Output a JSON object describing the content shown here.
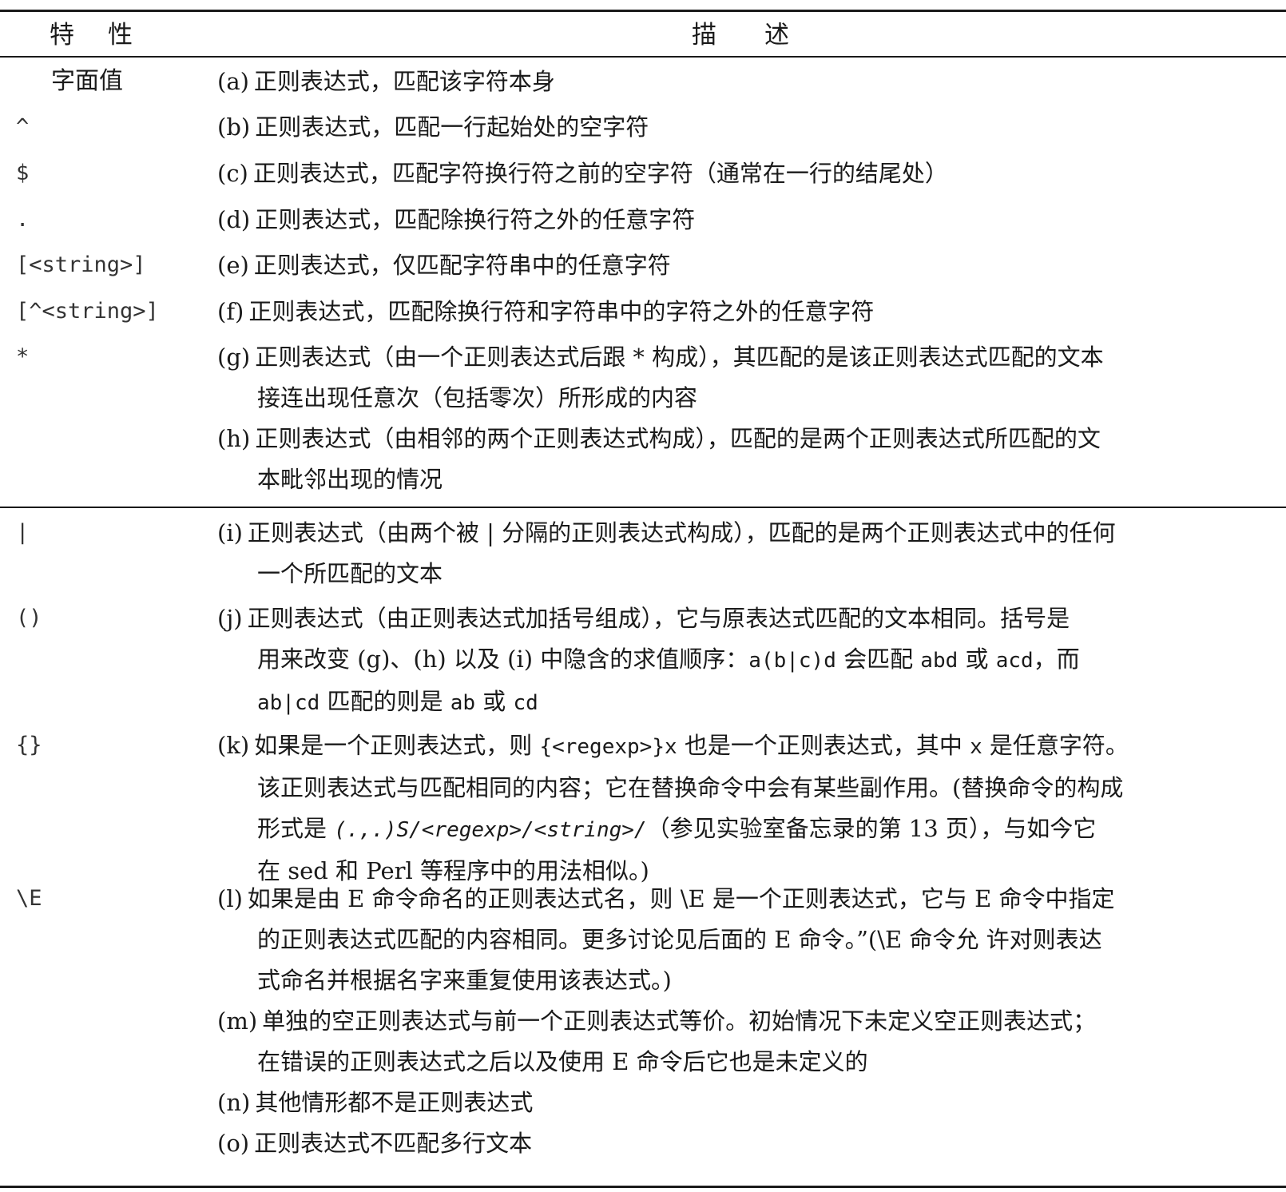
{
  "header": {
    "feature_a": "特",
    "feature_b": "性",
    "desc_a": "描",
    "desc_b": "述"
  },
  "rows": [
    {
      "feature": "字面值",
      "items": [
        {
          "tag": "(a)",
          "lines": [
            "正则表达式，匹配该字符本身"
          ]
        }
      ]
    },
    {
      "feature": "^",
      "items": [
        {
          "tag": "(b)",
          "lines": [
            "正则表达式，匹配一行起始处的空字符"
          ]
        }
      ]
    },
    {
      "feature": "$",
      "items": [
        {
          "tag": "(c)",
          "lines": [
            "正则表达式，匹配字符换行符之前的空字符（通常在一行的结尾处）"
          ]
        }
      ]
    },
    {
      "feature": ".",
      "items": [
        {
          "tag": "(d)",
          "lines": [
            "正则表达式，匹配除换行符之外的任意字符"
          ]
        }
      ]
    },
    {
      "feature": "[<string>]",
      "items": [
        {
          "tag": "(e)",
          "lines": [
            "正则表达式，仅匹配字符串中的任意字符"
          ]
        }
      ]
    },
    {
      "feature": "[^<string>]",
      "items": [
        {
          "tag": "(f)",
          "lines": [
            "正则表达式，匹配除换行符和字符串中的字符之外的任意字符"
          ]
        }
      ]
    },
    {
      "feature": "*",
      "items": [
        {
          "tag": "(g)",
          "lines": [
            "正则表达式（由一个正则表达式后跟 * 构成），其匹配的是该正则表达式匹配的文本",
            "接连出现任意次（包括零次）所形成的内容"
          ]
        },
        {
          "tag": "(h)",
          "lines": [
            "正则表达式（由相邻的两个正则表达式构成），匹配的是两个正则表达式所匹配的文",
            "本毗邻出现的情况"
          ]
        }
      ]
    },
    {
      "feature": "|",
      "items": [
        {
          "tag": "(i)",
          "lines": [
            "正则表达式（由两个被 | 分隔的正则表达式构成），匹配的是两个正则表达式中的任何",
            "一个所匹配的文本"
          ]
        }
      ]
    },
    {
      "feature": "()",
      "items": [
        {
          "tag": "(j)",
          "lines": [
            "正则表达式（由正则表达式加括号组成），它与原表达式匹配的文本相同。括号是"
          ]
        }
      ],
      "j_line2_a": "用来改变 (g)、(h) 以及 (i) 中隐含的求值顺序：",
      "j_code1": "a(b|c)d",
      "j_line2_b": " 会匹配 ",
      "j_code2": "abd",
      "j_line2_c": " 或 ",
      "j_code3": "acd",
      "j_line2_d": "，而",
      "j_code4": "ab|cd",
      "j_line3_a": " 匹配的则是 ",
      "j_code5": "ab",
      "j_line3_b": " 或 ",
      "j_code6": "cd"
    },
    {
      "feature": "{}",
      "k_tag": "(k)",
      "k1_a": "如果是一个正则表达式，则 ",
      "k1_code": "{<regexp>}x",
      "k1_b": " 也是一个正则表达式，其中 ",
      "k1_code2": "x",
      "k1_c": " 是任意字符。",
      "k2": "该正则表达式与匹配相同的内容；它在替换命令中会有某些副作用。(替换命令的构成",
      "k3_a": "形式是 ",
      "k3_code": "(.,.)S/<regexp>/<string>/",
      "k3_b": "（参见实验室备忘录的第 13 页），与如今它",
      "k4": "在 sed 和 Perl 等程序中的用法相似。)"
    },
    {
      "feature": "\\E",
      "items": [
        {
          "tag": "(l)",
          "lines": [
            "如果是由 E 命令命名的正则表达式名，则 \\E 是一个正则表达式，它与 E 命令中指定",
            "的正则表达式匹配的内容相同。更多讨论见后面的 E 命令。”(\\E 命令允 许对则表达",
            "式命名并根据名字来重复使用该表达式。)"
          ]
        },
        {
          "tag": "(m)",
          "lines": [
            "单独的空正则表达式与前一个正则表达式等价。初始情况下未定义空正则表达式；",
            "在错误的正则表达式之后以及使用 E 命令后它也是未定义的"
          ]
        },
        {
          "tag": "(n)",
          "lines": [
            "其他情形都不是正则表达式"
          ]
        },
        {
          "tag": "(o)",
          "lines": [
            "正则表达式不匹配多行文本"
          ]
        }
      ]
    }
  ]
}
